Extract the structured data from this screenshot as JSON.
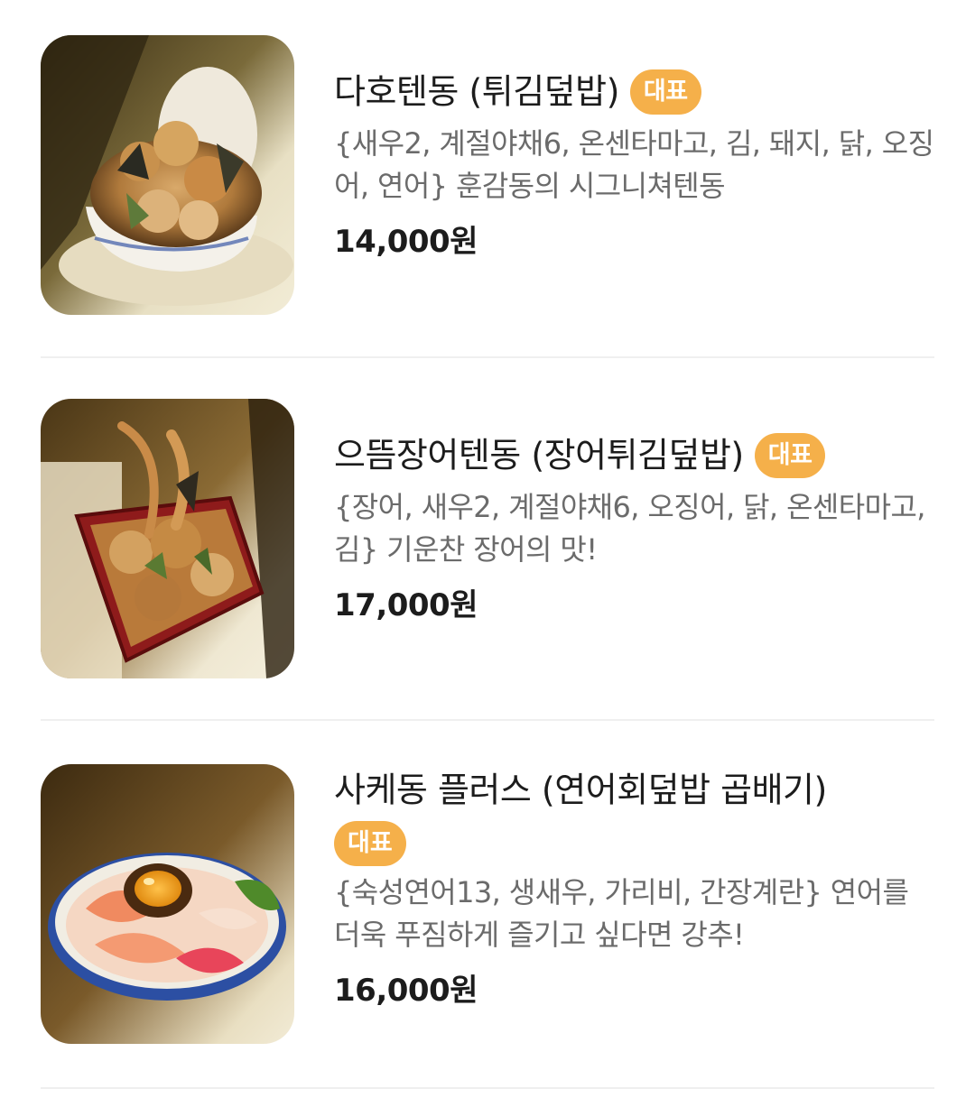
{
  "menu": {
    "items": [
      {
        "name": "다호텐동 (튀김덮밥)",
        "badge": "대표",
        "description": "{새우2, 계절야채6, 온센타마고, 김, 돼지, 닭, 오징어, 연어} 훈감동의 시그니쳐텐동",
        "price": "14,000원",
        "photo_icon": "tendon-bowl-photo"
      },
      {
        "name": "으뜸장어텐동 (장어튀김덮밥)",
        "badge": "대표",
        "description": "{장어, 새우2, 계절야채6, 오징어, 닭, 온센타마고, 김} 기운찬 장어의 맛!",
        "price": "17,000원",
        "photo_icon": "eel-tendon-box-photo"
      },
      {
        "name": "사케동 플러스 (연어회덮밥 곱배기)",
        "badge": "대표",
        "description": "{숙성연어13, 생새우, 가리비, 간장계란} 연어를 더욱 푸짐하게 즐기고 싶다면 강추!",
        "price": "16,000원",
        "photo_icon": "salmon-bowl-photo"
      }
    ]
  },
  "colors": {
    "badge": "#f5b04a",
    "title": "#1c1c1c",
    "description": "#6b6b6b",
    "divider": "#efefef"
  }
}
